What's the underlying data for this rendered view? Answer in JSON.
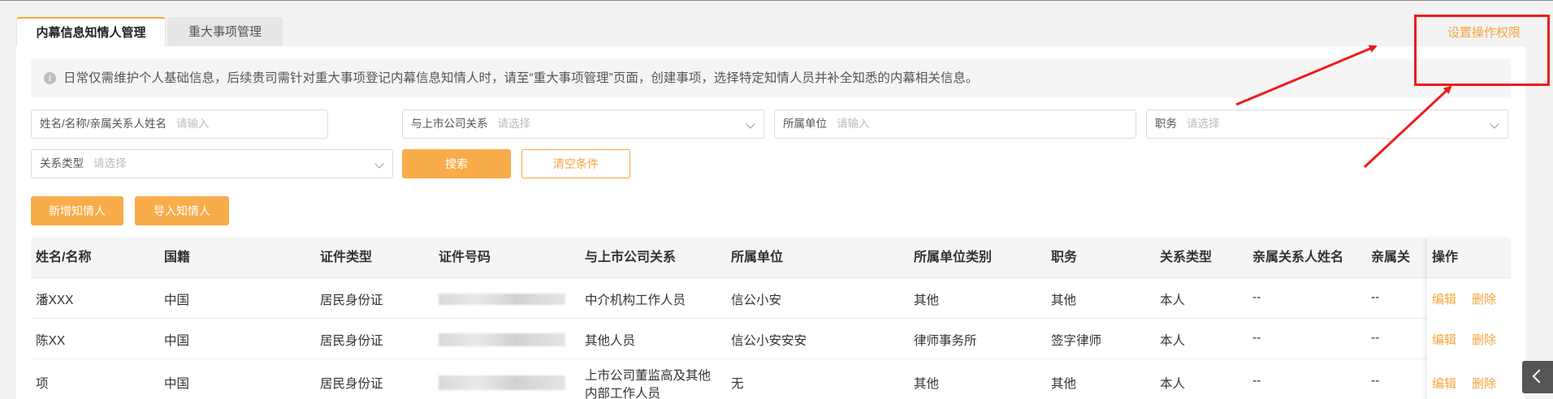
{
  "tabs": [
    {
      "label": "内幕信息知情人管理",
      "active": true
    },
    {
      "label": "重大事项管理",
      "active": false
    }
  ],
  "permission_link": "设置操作权限",
  "notice": {
    "icon": "info-icon",
    "text": "日常仅需维护个人基础信息，后续贵司需针对重大事项登记内幕信息知情人时，请至“重大事项管理”页面，创建事项，选择特定知情人员并补全知悉的内幕相关信息。"
  },
  "filters": {
    "name": {
      "label": "姓名/名称/亲属关系人姓名",
      "placeholder": "请输入"
    },
    "relation": {
      "label": "与上市公司关系",
      "placeholder": "请选择"
    },
    "unit": {
      "label": "所属单位",
      "placeholder": "请输入"
    },
    "position": {
      "label": "职务",
      "placeholder": "请选择"
    },
    "relation_type": {
      "label": "关系类型",
      "placeholder": "请选择"
    }
  },
  "buttons": {
    "search": "搜索",
    "clear": "清空条件",
    "add": "新增知情人",
    "import": "导入知情人"
  },
  "table": {
    "headers": [
      "姓名/名称",
      "国籍",
      "证件类型",
      "证件号码",
      "与上市公司关系",
      "所属单位",
      "所属单位类别",
      "职务",
      "关系类型",
      "亲属关系人姓名",
      "亲属关"
    ],
    "op_header": "操作",
    "rows": [
      {
        "name": "潘XXX",
        "nationality": "中国",
        "id_type": "居民身份证",
        "relation": "中介机构工作人员",
        "relation2": "",
        "unit": "信公小安",
        "unit_type": "其他",
        "position": "其他",
        "relation_type": "本人",
        "relative_name": "--",
        "relative_rel": "--",
        "edit": "编辑",
        "delete": "删除"
      },
      {
        "name": "陈XX",
        "nationality": "中国",
        "id_type": "居民身份证",
        "relation": "其他人员",
        "relation2": "",
        "unit": "信公小安安安",
        "unit_type": "律师事务所",
        "position": "签字律师",
        "relation_type": "本人",
        "relative_name": "--",
        "relative_rel": "--",
        "edit": "编辑",
        "delete": "删除"
      },
      {
        "name": "项",
        "nationality": "中国",
        "id_type": "居民身份证",
        "relation": "上市公司董监高及其他",
        "relation2": "内部工作人员",
        "unit": "无",
        "unit_type": "其他",
        "position": "其他",
        "relation_type": "本人",
        "relative_name": "--",
        "relative_rel": "--",
        "edit": "编辑",
        "delete": "删除"
      }
    ]
  },
  "colors": {
    "accent": "#f5a53c",
    "annotation": "#ee1c1c"
  }
}
